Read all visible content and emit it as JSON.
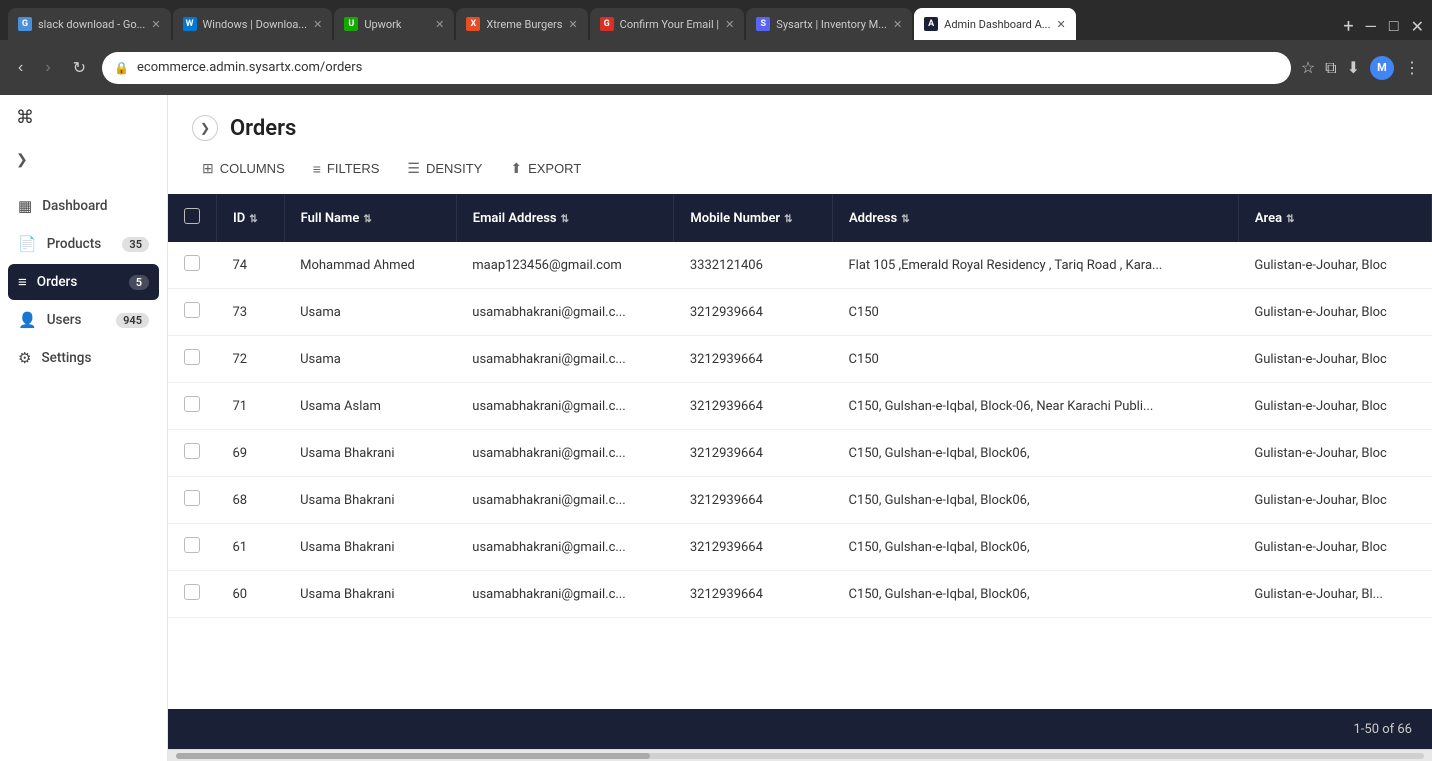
{
  "browser": {
    "tabs": [
      {
        "id": "slack",
        "label": "slack download - Go...",
        "favicon_color": "#4a90d9",
        "favicon_text": "G",
        "active": false
      },
      {
        "id": "windows",
        "label": "Windows | Downloa...",
        "favicon_color": "#0078d4",
        "favicon_text": "W",
        "active": false
      },
      {
        "id": "upwork",
        "label": "Upwork",
        "favicon_color": "#14a800",
        "favicon_text": "U",
        "active": false
      },
      {
        "id": "xtreme",
        "label": "Xtreme Burgers",
        "favicon_color": "#e44d26",
        "favicon_text": "X",
        "active": false
      },
      {
        "id": "confirm",
        "label": "Confirm Your Email |",
        "favicon_color": "#d93025",
        "favicon_text": "G",
        "active": false
      },
      {
        "id": "sysartx",
        "label": "Sysartx | Inventory M...",
        "favicon_color": "#5865f2",
        "favicon_text": "S",
        "active": false
      },
      {
        "id": "admin",
        "label": "Admin Dashboard A...",
        "favicon_color": "#1a2035",
        "favicon_text": "A",
        "active": true
      }
    ],
    "url": "ecommerce.admin.sysartx.com/orders",
    "window_controls": [
      "—",
      "□",
      "✕"
    ]
  },
  "sidebar": {
    "cmd_icon": "⌘",
    "toggle_icon": "❯",
    "items": [
      {
        "id": "dashboard",
        "label": "Dashboard",
        "icon": "▦",
        "badge": null,
        "active": false
      },
      {
        "id": "products",
        "label": "Products",
        "icon": "📄",
        "badge": "35",
        "active": false
      },
      {
        "id": "orders",
        "label": "Orders",
        "icon": "≡",
        "badge": "5",
        "active": true
      },
      {
        "id": "users",
        "label": "Users",
        "icon": "👤",
        "badge": "945",
        "active": false
      },
      {
        "id": "settings",
        "label": "Settings",
        "icon": "⚙",
        "badge": null,
        "active": false
      }
    ]
  },
  "page": {
    "title": "Orders",
    "expand_icon": "❯",
    "toolbar": {
      "columns_label": "COLUMNS",
      "filters_label": "FILTERS",
      "density_label": "DENSITY",
      "export_label": "EXPORT"
    },
    "table": {
      "columns": [
        {
          "id": "checkbox",
          "label": ""
        },
        {
          "id": "id",
          "label": "ID"
        },
        {
          "id": "fullname",
          "label": "Full Name"
        },
        {
          "id": "email",
          "label": "Email Address"
        },
        {
          "id": "mobile",
          "label": "Mobile Number"
        },
        {
          "id": "address",
          "label": "Address"
        },
        {
          "id": "area",
          "label": "Area"
        }
      ],
      "rows": [
        {
          "id": "74",
          "fullname": "Mohammad Ahmed",
          "email": "maap123456@gmail.com",
          "mobile": "3332121406",
          "address": "Flat 105 ,Emerald Royal Residency , Tariq Road , Kara...",
          "area": "Gulistan-e-Jouhar, Bloc"
        },
        {
          "id": "73",
          "fullname": "Usama",
          "email": "usamabhakrani@gmail.c...",
          "mobile": "3212939664",
          "address": "C150",
          "area": "Gulistan-e-Jouhar, Bloc"
        },
        {
          "id": "72",
          "fullname": "Usama",
          "email": "usamabhakrani@gmail.c...",
          "mobile": "3212939664",
          "address": "C150",
          "area": "Gulistan-e-Jouhar, Bloc"
        },
        {
          "id": "71",
          "fullname": "Usama Aslam",
          "email": "usamabhakrani@gmail.c...",
          "mobile": "3212939664",
          "address": "C150, Gulshan-e-Iqbal, Block-06, Near Karachi Publi...",
          "area": "Gulistan-e-Jouhar, Bloc"
        },
        {
          "id": "69",
          "fullname": "Usama Bhakrani",
          "email": "usamabhakrani@gmail.c...",
          "mobile": "3212939664",
          "address": "C150, Gulshan-e-Iqbal, Block06,",
          "area": "Gulistan-e-Jouhar, Bloc"
        },
        {
          "id": "68",
          "fullname": "Usama Bhakrani",
          "email": "usamabhakrani@gmail.c...",
          "mobile": "3212939664",
          "address": "C150, Gulshan-e-Iqbal, Block06,",
          "area": "Gulistan-e-Jouhar, Bloc"
        },
        {
          "id": "61",
          "fullname": "Usama Bhakrani",
          "email": "usamabhakrani@gmail.c...",
          "mobile": "3212939664",
          "address": "C150, Gulshan-e-Iqbal, Block06,",
          "area": "Gulistan-e-Jouhar, Bloc"
        },
        {
          "id": "60",
          "fullname": "Usama Bhakrani",
          "email": "usamabhakrani@gmail.c...",
          "mobile": "3212939664",
          "address": "C150, Gulshan-e-Iqbal, Block06,",
          "area": "Gulistan-e-Jouhar, Bl..."
        }
      ]
    },
    "footer": {
      "pagination": "1-50 of 66"
    }
  }
}
